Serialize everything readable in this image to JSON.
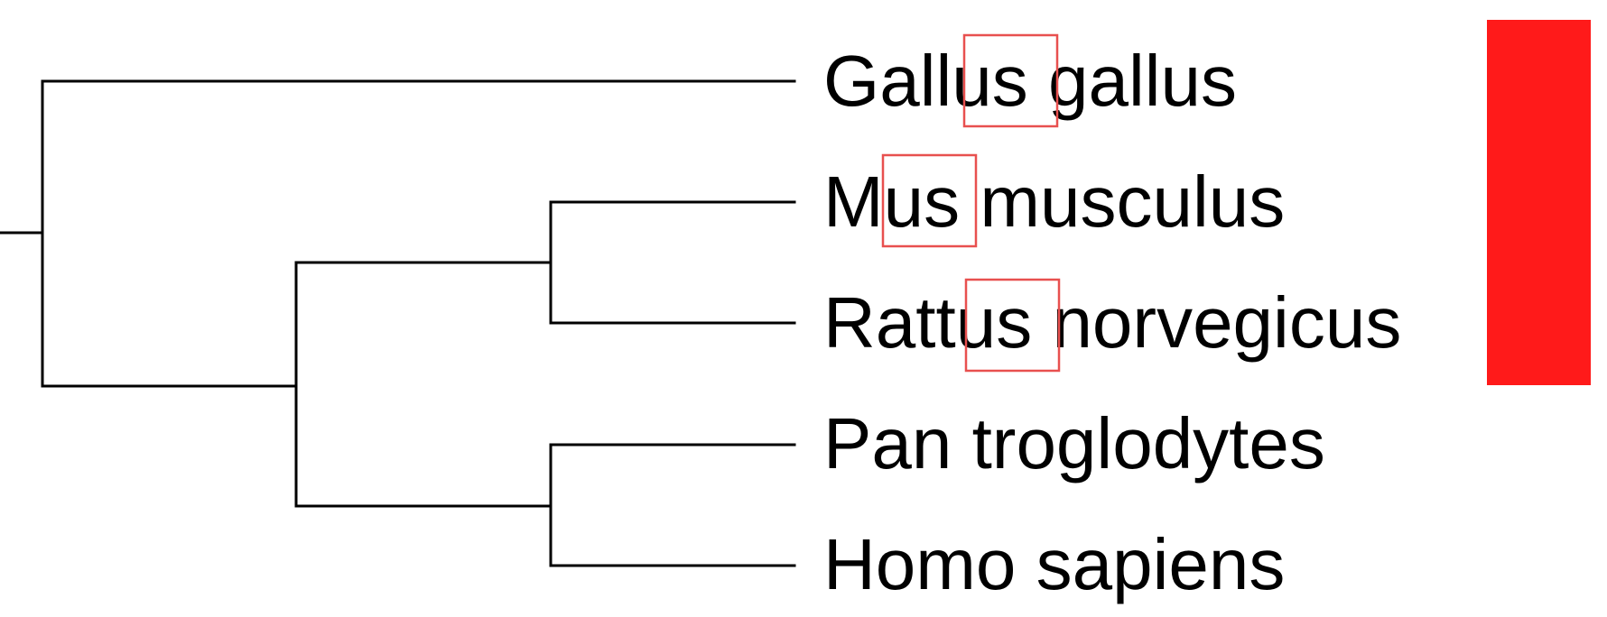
{
  "diagram": {
    "kind": "phylogenetic-tree",
    "taxa": [
      {
        "name": "Gallus gallus",
        "highlight": "us"
      },
      {
        "name": "Mus musculus",
        "highlight": "us"
      },
      {
        "name": "Rattus norvegicus",
        "highlight": "us"
      },
      {
        "name": "Pan troglodytes",
        "highlight": ""
      },
      {
        "name": "Homo sapiens",
        "highlight": ""
      }
    ],
    "clade_bar_taxa": [
      "Gallus gallus",
      "Mus musculus",
      "Rattus norvegicus"
    ]
  },
  "colors": {
    "branch": "#000000",
    "highlight_box": "#e8504f",
    "clade_bar": "#ff1a1a",
    "text": "#000000"
  }
}
